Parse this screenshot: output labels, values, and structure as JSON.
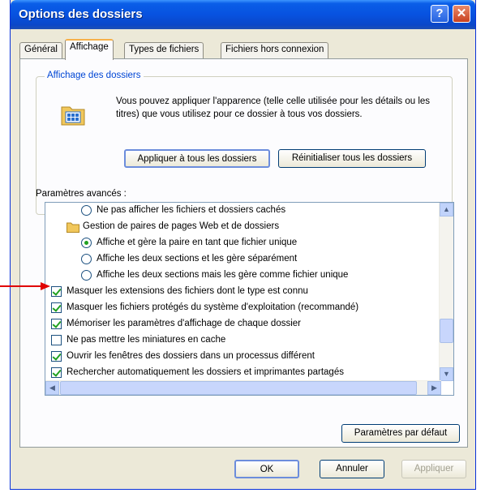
{
  "window": {
    "title": "Options des dossiers",
    "help_glyph": "?",
    "close_glyph": "✕"
  },
  "tabs": [
    {
      "label": "Général"
    },
    {
      "label": "Affichage"
    },
    {
      "label": "Types de fichiers"
    },
    {
      "label": "Fichiers hors connexion"
    }
  ],
  "folder_view": {
    "group_label": "Affichage des dossiers",
    "description": "Vous pouvez appliquer l'apparence (telle celle utilisée pour les détails ou les titres) que vous utilisez pour ce dossier à tous vos dossiers.",
    "apply_all_label": "Appliquer à tous les dossiers",
    "reset_all_label": "Réinitialiser tous les dossiers"
  },
  "advanced": {
    "label": "Paramètres avancés :",
    "items": [
      {
        "type": "radio",
        "checked": false,
        "label": "Ne pas afficher les fichiers et dossiers cachés"
      },
      {
        "type": "folder",
        "label": "Gestion de paires de pages Web et de dossiers"
      },
      {
        "type": "radio",
        "checked": true,
        "label": "Affiche et gère la paire en tant que fichier unique"
      },
      {
        "type": "radio",
        "checked": false,
        "label": "Affiche les deux sections et les gère séparément"
      },
      {
        "type": "radio",
        "checked": false,
        "label": "Affiche les deux sections mais les gère comme fichier unique"
      },
      {
        "type": "check",
        "checked": true,
        "label": "Masquer les extensions des fichiers dont le type est connu"
      },
      {
        "type": "check",
        "checked": true,
        "label": "Masquer les fichiers protégés du système d'exploitation (recommandé)"
      },
      {
        "type": "check",
        "checked": true,
        "label": "Mémoriser les paramètres d'affichage de chaque dossier"
      },
      {
        "type": "check",
        "checked": false,
        "label": "Ne pas mettre les miniatures en cache"
      },
      {
        "type": "check",
        "checked": true,
        "label": "Ouvrir les fenêtres des dossiers dans un processus différent"
      },
      {
        "type": "check",
        "checked": true,
        "label": "Rechercher automatiquement les dossiers et imprimantes partagés"
      }
    ],
    "scroll_up": "▲",
    "scroll_down": "▼",
    "scroll_left": "◀",
    "scroll_right": "▶"
  },
  "defaults_label": "Paramètres par défaut",
  "footer": {
    "ok": "OK",
    "cancel": "Annuler",
    "apply": "Appliquer"
  },
  "colors": {
    "titlebar": "#0a5ee8",
    "annotation_arrow": "#e00000",
    "check_green": "#21a121"
  }
}
